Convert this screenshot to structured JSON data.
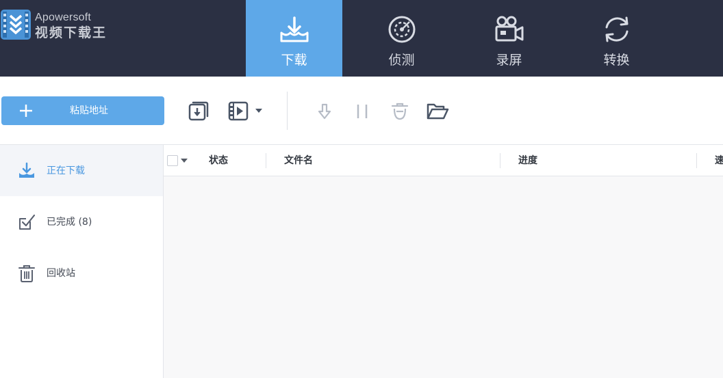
{
  "app": {
    "brand": "Apowersoft",
    "name": "视频下载王"
  },
  "nav": {
    "tabs": [
      {
        "label": "下载",
        "icon": "download-tray-icon",
        "active": true
      },
      {
        "label": "侦测",
        "icon": "radar-icon",
        "active": false
      },
      {
        "label": "录屏",
        "icon": "video-camera-icon",
        "active": false
      },
      {
        "label": "转换",
        "icon": "convert-cycle-icon",
        "active": false
      }
    ]
  },
  "toolbar": {
    "paste_label": "粘贴地址",
    "tools": [
      {
        "name": "download-file-icon",
        "enabled": true
      },
      {
        "name": "download-video-icon",
        "enabled": true
      },
      {
        "name": "start-icon",
        "enabled": false
      },
      {
        "name": "pause-icon",
        "enabled": false
      },
      {
        "name": "delete-icon",
        "enabled": false
      },
      {
        "name": "open-folder-icon",
        "enabled": true
      }
    ]
  },
  "sidebar": {
    "items": [
      {
        "label": "正在下载",
        "icon": "downloading-icon",
        "active": true
      },
      {
        "label": "已完成 (8)",
        "icon": "completed-check-icon",
        "active": false
      },
      {
        "label": "回收站",
        "icon": "trash-icon",
        "active": false
      }
    ]
  },
  "table": {
    "columns": [
      "状态",
      "文件名",
      "进度",
      "速"
    ],
    "rows": []
  },
  "colors": {
    "header_bg": "#2b3043",
    "accent": "#5ea8e8",
    "active_text": "#4a98e0"
  }
}
